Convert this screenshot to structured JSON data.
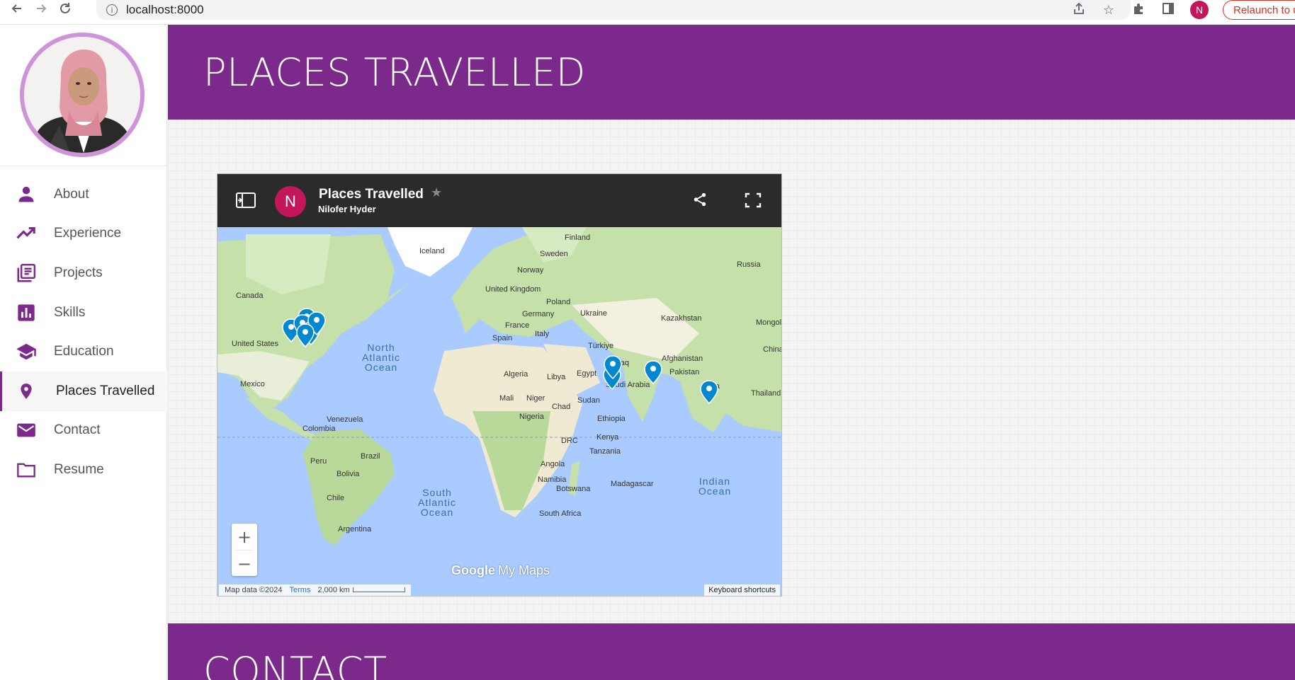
{
  "browser": {
    "url": "localhost:8000",
    "profile_initial": "N",
    "relaunch_label": "Relaunch to update"
  },
  "sidebar": {
    "items": [
      {
        "label": "About",
        "icon": "person-icon",
        "active": false
      },
      {
        "label": "Experience",
        "icon": "trending-up-icon",
        "active": false
      },
      {
        "label": "Projects",
        "icon": "library-books-icon",
        "active": false
      },
      {
        "label": "Skills",
        "icon": "bar-chart-icon",
        "active": false
      },
      {
        "label": "Education",
        "icon": "school-icon",
        "active": false
      },
      {
        "label": "Places Travelled",
        "icon": "location-pin-icon",
        "active": true
      },
      {
        "label": "Contact",
        "icon": "mail-icon",
        "active": false
      },
      {
        "label": "Resume",
        "icon": "folder-icon",
        "active": false
      }
    ]
  },
  "sections": {
    "places_title": "PLACES TRAVELLED",
    "contact_title": "CONTACT"
  },
  "map": {
    "title": "Places Travelled",
    "author": "Nilofer Hyder",
    "author_initial": "N",
    "zoom_in": "+",
    "zoom_out": "−",
    "logo_google": "Google",
    "logo_mymaps": "My Maps",
    "attribution": "Map data ©2024",
    "terms": "Terms",
    "scale": "2,000 km",
    "keyboard_shortcuts": "Keyboard shortcuts",
    "labels": {
      "iceland": "Iceland",
      "finland": "Finland",
      "sweden": "Sweden",
      "norway": "Norway",
      "russia": "Russia",
      "uk": "United Kingdom",
      "poland": "Poland",
      "germany": "Germany",
      "ukraine": "Ukraine",
      "kazakhstan": "Kazakhstan",
      "mongolia": "Mongol",
      "france": "France",
      "italy": "Italy",
      "spain": "Spain",
      "turkiye": "Türkiye",
      "china": "China",
      "afghanistan": "Afghanistan",
      "iraq": "Iraq",
      "pakistan": "Pakistan",
      "saudi": "Saudi Arabia",
      "india": "India",
      "thailand": "Thailand",
      "canada": "Canada",
      "us": "United States",
      "mexico": "Mexico",
      "algeria": "Algeria",
      "libya": "Libya",
      "egypt": "Egypt",
      "mali": "Mali",
      "niger": "Niger",
      "chad": "Chad",
      "sudan": "Sudan",
      "nigeria": "Nigeria",
      "ethiopia": "Ethiopia",
      "kenya": "Kenya",
      "drc": "DRC",
      "tanzania": "Tanzania",
      "angola": "Angola",
      "namibia": "Namibia",
      "botswana": "Botswana",
      "madagascar": "Madagascar",
      "south_africa": "South Africa",
      "venezuela": "Venezuela",
      "colombia": "Colombia",
      "peru": "Peru",
      "brazil": "Brazil",
      "bolivia": "Bolivia",
      "chile": "Chile",
      "argentina": "Argentina",
      "north_atlantic": [
        "North",
        "Atlantic",
        "Ocean"
      ],
      "south_atlantic": [
        "South",
        "Atlantic",
        "Ocean"
      ],
      "indian_ocean": [
        "Indian",
        "Ocean"
      ]
    }
  },
  "colors": {
    "brand_purple": "#7b2a8b",
    "avatar_ring": "#ce93d8",
    "profile_badge": "#c2185b",
    "pin_blue": "#0288d1",
    "ocean": "#aacbff",
    "land": "#c9e2b1"
  }
}
